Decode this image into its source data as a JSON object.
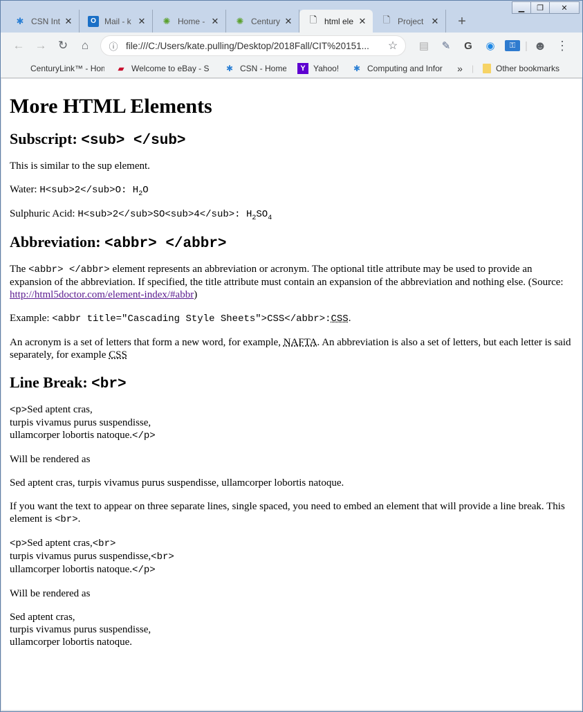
{
  "window_controls": {
    "minimize": "▁",
    "maximize": "❐",
    "close": "✕"
  },
  "tabs": [
    {
      "label": "CSN Int",
      "icon": "csn-star-icon",
      "active": false
    },
    {
      "label": "Mail - k",
      "icon": "outlook-icon",
      "active": false
    },
    {
      "label": "Home -",
      "icon": "centurylink-icon",
      "active": false
    },
    {
      "label": "Century",
      "icon": "centurylink-icon",
      "active": false
    },
    {
      "label": "html ele",
      "icon": "document-icon",
      "active": true
    },
    {
      "label": "Project",
      "icon": "document-icon",
      "active": false
    }
  ],
  "toolbar": {
    "url": "file:///C:/Users/kate.pulling/Desktop/2018Fall/CIT%20151..."
  },
  "bookmarks": [
    {
      "label": "CenturyLink™ - Hom",
      "icon": "centurylink-icon"
    },
    {
      "label": "Welcome to eBay - S",
      "icon": "ebay-icon"
    },
    {
      "label": "CSN - Home",
      "icon": "csn-star-icon"
    },
    {
      "label": "Yahoo!",
      "icon": "yahoo-icon"
    },
    {
      "label": "Computing and Infor",
      "icon": "csn-star-icon"
    }
  ],
  "bookmarks_overflow": "»",
  "other_bookmarks": "Other bookmarks",
  "page": {
    "title": "More HTML Elements",
    "sub_section": {
      "heading": "Subscript: ",
      "heading_code": "<sub> </sub>",
      "intro": "This is similar to the sup element.",
      "water_label": "Water: ",
      "water_code": "H<sub>2</sub>O: ",
      "water_h": "H",
      "water_sub": "2",
      "water_o": "O",
      "acid_label": "Sulphuric Acid: ",
      "acid_code": "H<sub>2</sub>SO<sub>4</sub>: ",
      "acid_h": "H",
      "acid_sub1": "2",
      "acid_so": "SO",
      "acid_sub2": "4"
    },
    "abbr_section": {
      "heading": "Abbreviation: ",
      "heading_code": "<abbr> </abbr>",
      "p1_a": "The ",
      "p1_code": "<abbr> </abbr>",
      "p1_b": " element represents an abbreviation or acronym. The optional title attribute may be used to provide an expansion of the abbreviation. If specified, the title attribute must contain an expansion of the abbreviation and nothing else. (Source: ",
      "p1_link": "http://html5doctor.com/element-index/#abbr",
      "p1_c": ")",
      "example_label": "Example: ",
      "example_code": "<abbr title=\"Cascading Style Sheets\">CSS</abbr>:",
      "example_abbr": "CSS",
      "example_end": ".",
      "p3_a": "An acronym is a set of letters that form a new word, for example, ",
      "p3_abbr1": "NAFTA",
      "p3_b": ". An abbreviation is also a set of letters, but each letter is said separately, for example ",
      "p3_abbr2": "CSS"
    },
    "br_section": {
      "heading": "Line Break: ",
      "heading_code": "<br>",
      "code1_l1_tag": "<p>",
      "code1_l1": "Sed aptent cras,",
      "code1_l2": "turpis vivamus purus suspendisse,",
      "code1_l3": "ullamcorper lobortis natoque.",
      "code1_l3_tag": "</p>",
      "rendered_label_1": "Will be rendered as",
      "rendered_1": "Sed aptent cras, turpis vivamus purus suspendisse, ullamcorper lobortis natoque.",
      "explain_a": "If you want the text to appear on three separate lines, single spaced, you need to embed an element that will provide a line break. This element is ",
      "explain_code": "<br>",
      "explain_b": ".",
      "code2_l1_tag": "<p>",
      "code2_l1": "Sed aptent cras,",
      "code2_l1_br": "<br>",
      "code2_l2": "turpis vivamus purus suspendisse,",
      "code2_l2_br": "<br>",
      "code2_l3": "ullamcorper lobortis natoque.",
      "code2_l3_tag": "</p>",
      "rendered_label_2": "Will be rendered as",
      "rendered_2_l1": "Sed aptent cras,",
      "rendered_2_l2": "turpis vivamus purus suspendisse,",
      "rendered_2_l3": "ullamcorper lobortis natoque."
    }
  }
}
